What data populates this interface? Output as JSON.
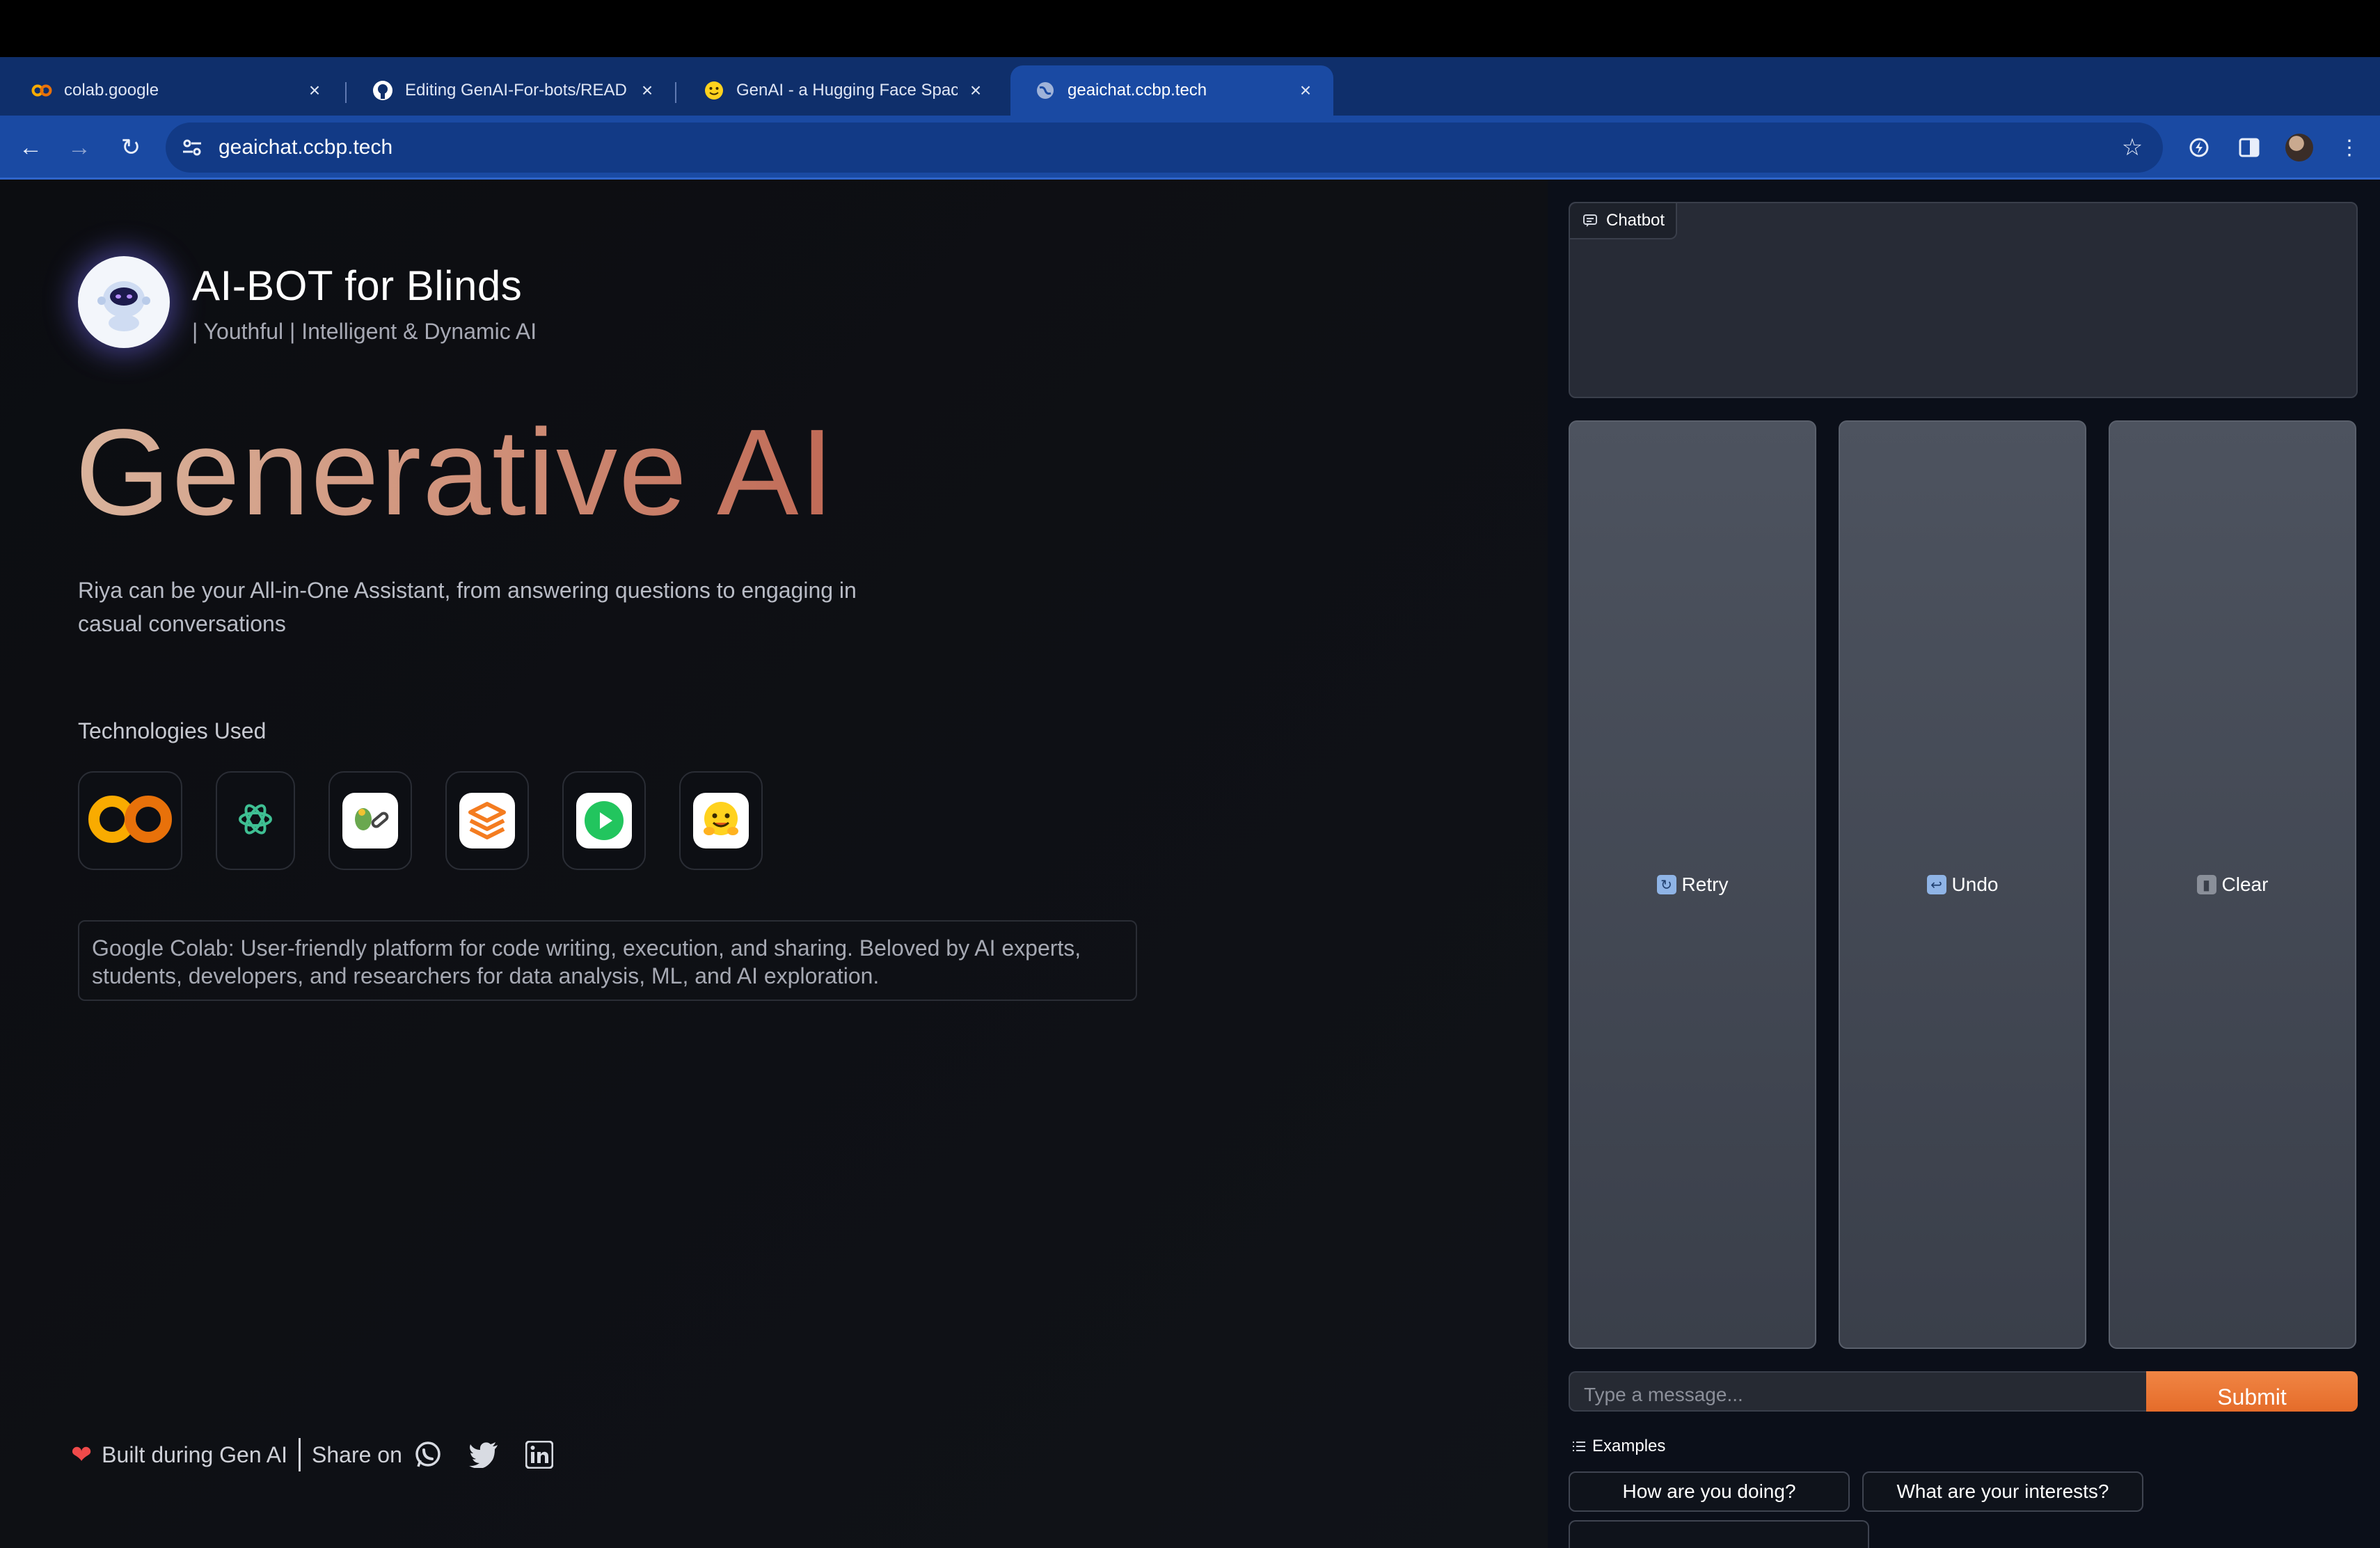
{
  "browser": {
    "tabs": [
      {
        "title": "colab.google",
        "favicon": "colab-icon"
      },
      {
        "title": "Editing GenAI-For-bots/READ",
        "favicon": "github-icon"
      },
      {
        "title": "GenAI - a Hugging Face Spac",
        "favicon": "huggingface-icon"
      },
      {
        "title": "geaichat.ccbp.tech",
        "favicon": "globe-icon",
        "active": true
      }
    ],
    "new_tab": "+",
    "url": "geaichat.ccbp.tech"
  },
  "header": {
    "title": "AI-BOT for Blinds",
    "subtitle": "| Youthful | Intelligent & Dynamic AI"
  },
  "hero": {
    "title": "Generative AI",
    "description": "Riya can be your All-in-One Assistant, from answering questions to engaging in casual conversations"
  },
  "technologies": {
    "title": "Technologies Used",
    "items": [
      "google-colab-icon",
      "openai-icon",
      "langchain-icon",
      "gradio-icon",
      "play-icon",
      "huggingface-icon"
    ],
    "info": "Google Colab: User-friendly platform for code writing, execution, and sharing. Beloved by AI experts, students, developers, and researchers for data analysis, ML, and AI exploration."
  },
  "footer": {
    "built": "Built during Gen AI",
    "share": "Share on",
    "socials": [
      "whatsapp-icon",
      "twitter-icon",
      "linkedin-icon"
    ]
  },
  "chat": {
    "chatbot_label": "Chatbot",
    "buttons": {
      "retry": "Retry",
      "undo": "Undo",
      "clear": "Clear"
    },
    "input_placeholder": "Type a message...",
    "submit": "Submit",
    "examples_label": "Examples",
    "examples": [
      "How are you doing?",
      "What are your interests?"
    ]
  },
  "colors": {
    "accent": "#e56c2a",
    "chrome": "#1a4aa3",
    "hero_gradient": [
      "#d9b39c",
      "#c06a56"
    ]
  }
}
